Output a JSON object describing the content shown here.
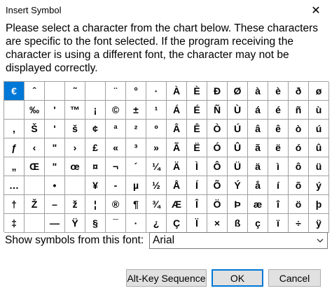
{
  "window": {
    "title": "Insert Symbol",
    "close_glyph": "✕"
  },
  "instructions": "Please select a character from the chart below.  These characters are specific to the font selected.  If the program receiving the character is using a different font, the character may not be displayed correctly.",
  "symbols": [
    [
      "€",
      "ˆ",
      "",
      "˜",
      "",
      "¨",
      "°",
      "·",
      "À",
      "È",
      "Ð",
      "Ø",
      "à",
      "è",
      "ð",
      "ø"
    ],
    [
      "",
      "‰",
      "'",
      "™",
      "¡",
      "©",
      "±",
      "¹",
      "Á",
      "É",
      "Ñ",
      "Ù",
      "á",
      "é",
      "ñ",
      "ù"
    ],
    [
      ",",
      "Š",
      "'",
      "š",
      "¢",
      "ª",
      "²",
      "º",
      "Â",
      "Ê",
      "Ò",
      "Ú",
      "â",
      "ê",
      "ò",
      "ú"
    ],
    [
      "ƒ",
      "‹",
      "\"",
      "›",
      "£",
      "«",
      "³",
      "»",
      "Ã",
      "Ë",
      "Ó",
      "Û",
      "ã",
      "ë",
      "ó",
      "û"
    ],
    [
      "„",
      "Œ",
      "\"",
      "œ",
      "¤",
      "¬",
      "´",
      "¼",
      "Ä",
      "Ì",
      "Ô",
      "Ü",
      "ä",
      "ì",
      "ô",
      "ü"
    ],
    [
      "…",
      "",
      "•",
      "",
      "¥",
      "-",
      "µ",
      "½",
      "Å",
      "Í",
      "Õ",
      "Ý",
      "å",
      "í",
      "õ",
      "ý"
    ],
    [
      "†",
      "Ž",
      "–",
      "ž",
      "¦",
      "®",
      "¶",
      "¾",
      "Æ",
      "Î",
      "Ö",
      "Þ",
      "æ",
      "î",
      "ö",
      "þ"
    ],
    [
      "‡",
      "",
      "—",
      "Ÿ",
      "§",
      "¯",
      "·",
      "¿",
      "Ç",
      "Ï",
      "×",
      "ß",
      "ç",
      "ï",
      "÷",
      "ÿ"
    ]
  ],
  "selected_symbol": "€",
  "font_selector": {
    "label": "Show symbols from this font:",
    "value": "Arial"
  },
  "buttons": {
    "altkey": "Alt-Key Sequence",
    "ok": "OK",
    "cancel": "Cancel"
  },
  "colors": {
    "selection": "#0078d7",
    "grid_line": "#a0a0a0",
    "button_face": "#e1e1e1"
  }
}
